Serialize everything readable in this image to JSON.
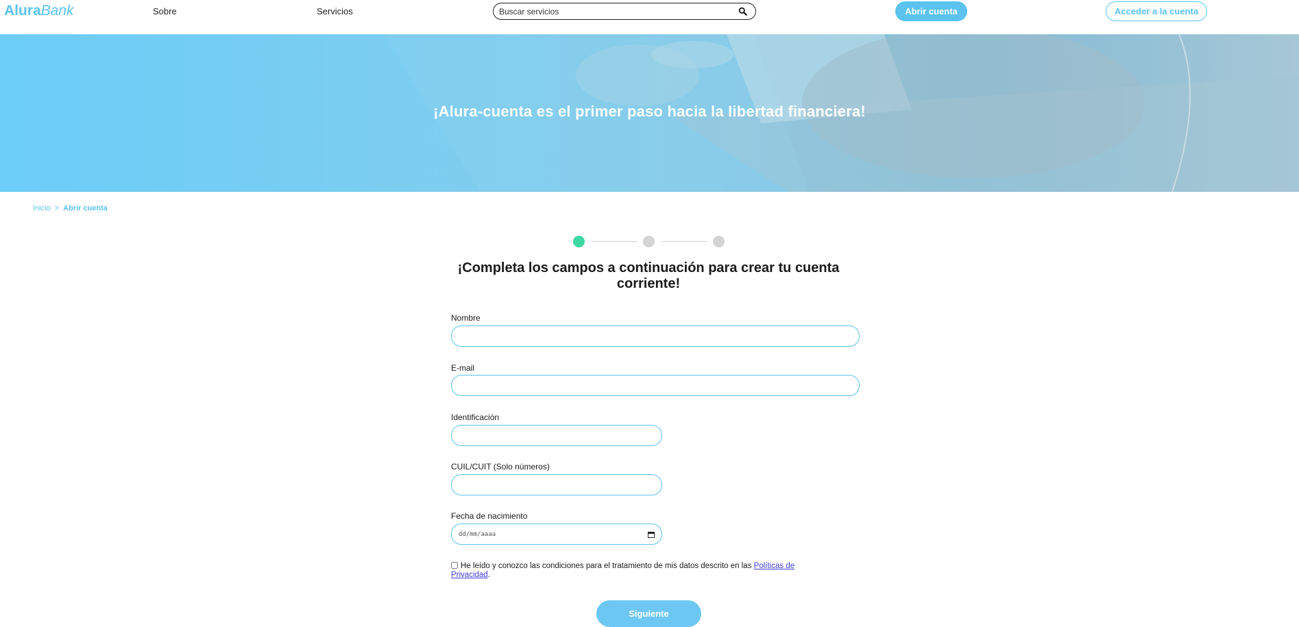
{
  "header": {
    "logo_bold": "Alura",
    "logo_italic": "Bank",
    "nav": [
      "Sobre",
      "Servicios"
    ],
    "search_placeholder": "Buscar servicios",
    "open_account": "Abrir cuenta",
    "access_account": "Acceder a la cuenta"
  },
  "hero": {
    "title": "¡Alura-cuenta es el primer paso hacia la libertad financiera!"
  },
  "breadcrumb": {
    "home": "Inicio",
    "separator": ">",
    "current": "Abrir cuenta"
  },
  "stepper": {
    "total_steps": 3,
    "current_step": 1,
    "active_color": "#3ed8a3",
    "inactive_color": "#d4d4d4"
  },
  "form": {
    "title": "¡Completa los campos a continuación para crear tu cuenta corriente!",
    "fields": {
      "nombre": "Nombre",
      "email": "E-mail",
      "identificacion": "Identificación",
      "cuil": "CUIL/CUIT (Solo números)",
      "fecha": "Fecha de nacimiento"
    },
    "date_placeholder": "dd/mm/aaaa",
    "consent_text": "He leído y conozco las condiciones para el tratamiento de mis datos descrito en las ",
    "consent_link": "Políticas de Privacidad",
    "consent_end": ".",
    "next_button": "Siguiente"
  },
  "colors": {
    "accent": "#5bc3ee",
    "success": "#3ed8a3"
  },
  "icons": {
    "search": "search-icon",
    "calendar": "calendar-icon"
  }
}
